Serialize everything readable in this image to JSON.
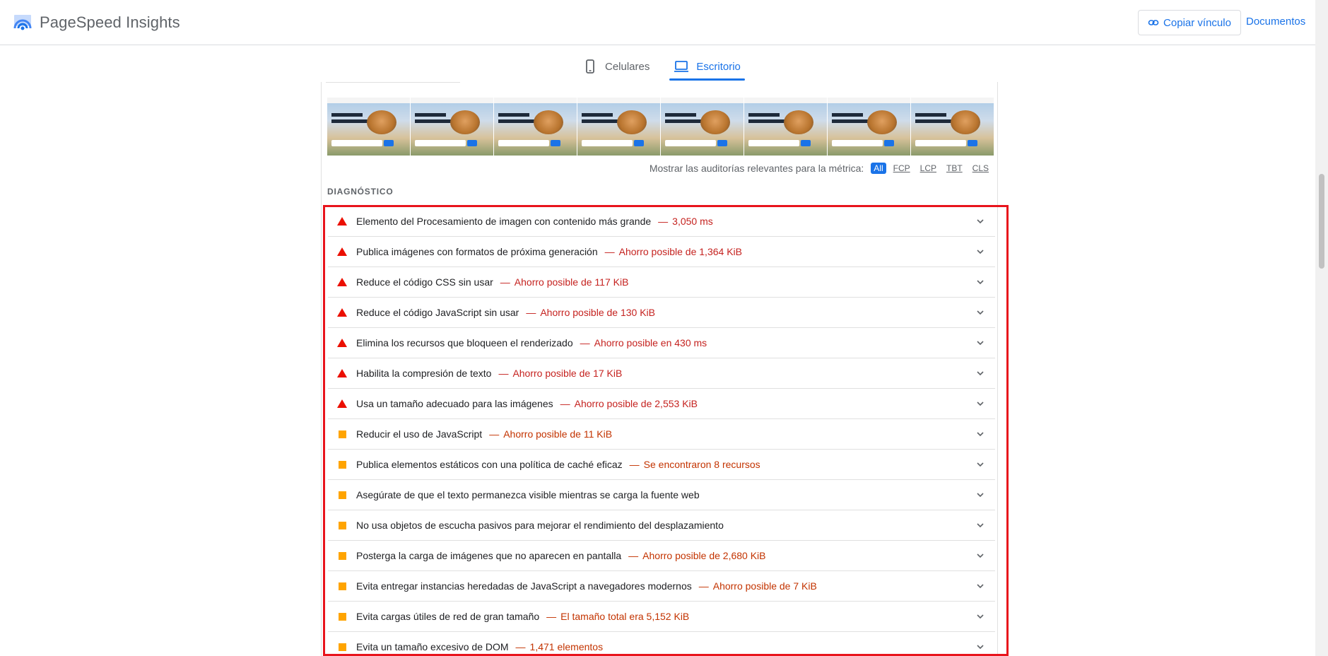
{
  "header": {
    "app_name": "PageSpeed Insights",
    "copy_link_label": "Copiar vínculo",
    "docs_label": "Documentos"
  },
  "tabs": [
    {
      "label": "Celulares",
      "icon": "smartphone-icon",
      "active": false
    },
    {
      "label": "Escritorio",
      "icon": "laptop-icon",
      "active": true
    }
  ],
  "filmstrip": {
    "frame_text_line1": "Day trips from",
    "frame_text_line2": "Malaga & Costa del Sol"
  },
  "metric_filter": {
    "label": "Mostrar las auditorías relevantes para la métrica:",
    "options": [
      "All",
      "FCP",
      "LCP",
      "TBT",
      "CLS"
    ],
    "selected": "All"
  },
  "diagnostics": {
    "heading": "DIAGNÓSTICO",
    "audits": [
      {
        "severity": "fail",
        "title": "Elemento del Procesamiento de imagen con contenido más grande",
        "detail": "3,050 ms"
      },
      {
        "severity": "fail",
        "title": "Publica imágenes con formatos de próxima generación",
        "detail": "Ahorro posible de 1,364 KiB"
      },
      {
        "severity": "fail",
        "title": "Reduce el código CSS sin usar",
        "detail": "Ahorro posible de 117 KiB"
      },
      {
        "severity": "fail",
        "title": "Reduce el código JavaScript sin usar",
        "detail": "Ahorro posible de 130 KiB"
      },
      {
        "severity": "fail",
        "title": "Elimina los recursos que bloqueen el renderizado",
        "detail": "Ahorro posible en 430 ms"
      },
      {
        "severity": "fail",
        "title": "Habilita la compresión de texto",
        "detail": "Ahorro posible de 17 KiB"
      },
      {
        "severity": "fail",
        "title": "Usa un tamaño adecuado para las imágenes",
        "detail": "Ahorro posible de 2,553 KiB"
      },
      {
        "severity": "average",
        "title": "Reducir el uso de JavaScript",
        "detail": "Ahorro posible de 11 KiB"
      },
      {
        "severity": "average",
        "title": "Publica elementos estáticos con una política de caché eficaz",
        "detail": "Se encontraron 8 recursos"
      },
      {
        "severity": "average",
        "title": "Asegúrate de que el texto permanezca visible mientras se carga la fuente web",
        "detail": ""
      },
      {
        "severity": "average",
        "title": "No usa objetos de escucha pasivos para mejorar el rendimiento del desplazamiento",
        "detail": ""
      },
      {
        "severity": "average",
        "title": "Posterga la carga de imágenes que no aparecen en pantalla",
        "detail": "Ahorro posible de 2,680 KiB"
      },
      {
        "severity": "average",
        "title": "Evita entregar instancias heredadas de JavaScript a navegadores modernos",
        "detail": "Ahorro posible de 7 KiB"
      },
      {
        "severity": "average",
        "title": "Evita cargas útiles de red de gran tamaño",
        "detail": "El tamaño total era 5,152 KiB"
      },
      {
        "severity": "average",
        "title": "Evita un tamaño excesivo de DOM",
        "detail": "1,471 elementos"
      }
    ]
  },
  "colors": {
    "accent": "#1a73e8",
    "fail": "#eb0f00",
    "average": "#ffa400",
    "highlight": "#e8141c"
  }
}
